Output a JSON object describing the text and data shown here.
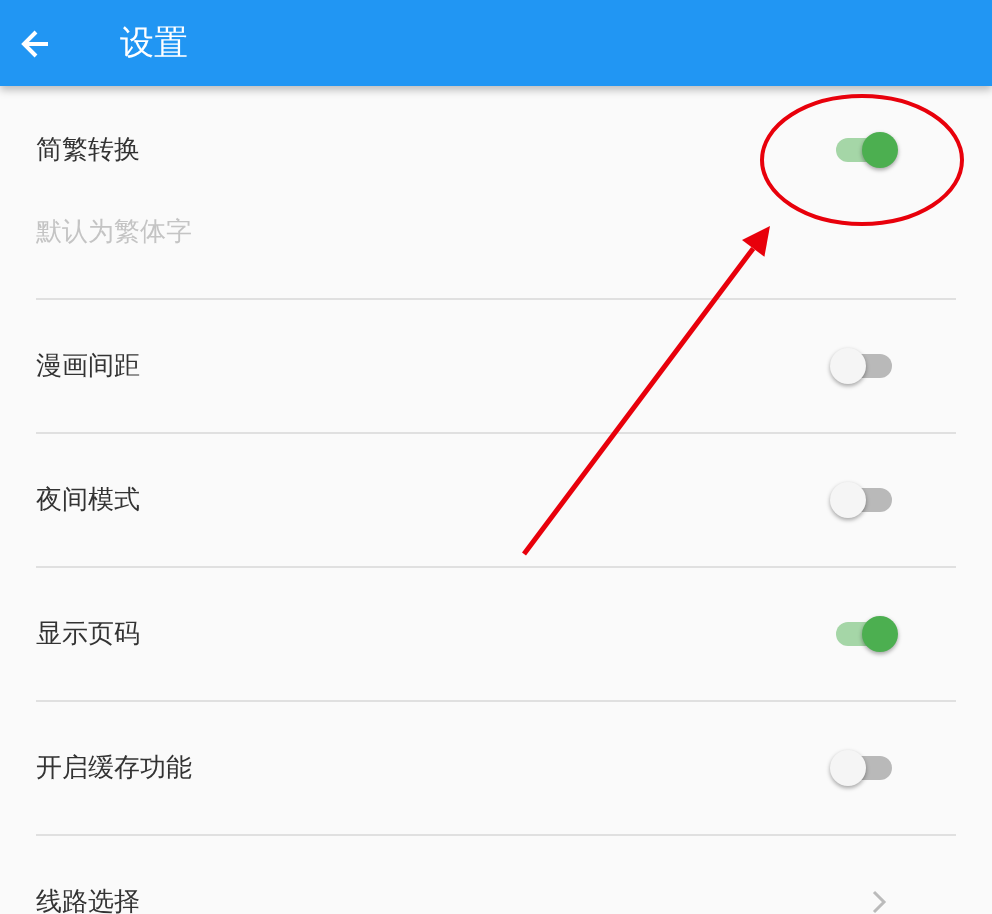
{
  "app_bar": {
    "title": "设置"
  },
  "settings": [
    {
      "kind": "toggle",
      "label": "简繁转换",
      "on": true,
      "subtitle": "默认为繁体字"
    },
    {
      "kind": "toggle",
      "label": "漫画间距",
      "on": false
    },
    {
      "kind": "toggle",
      "label": "夜间模式",
      "on": false
    },
    {
      "kind": "toggle",
      "label": "显示页码",
      "on": true
    },
    {
      "kind": "toggle",
      "label": "开启缓存功能",
      "on": false
    },
    {
      "kind": "link",
      "label": "线路选择"
    }
  ],
  "annotations": [
    {
      "kind": "ellipse"
    },
    {
      "kind": "arrow"
    }
  ]
}
